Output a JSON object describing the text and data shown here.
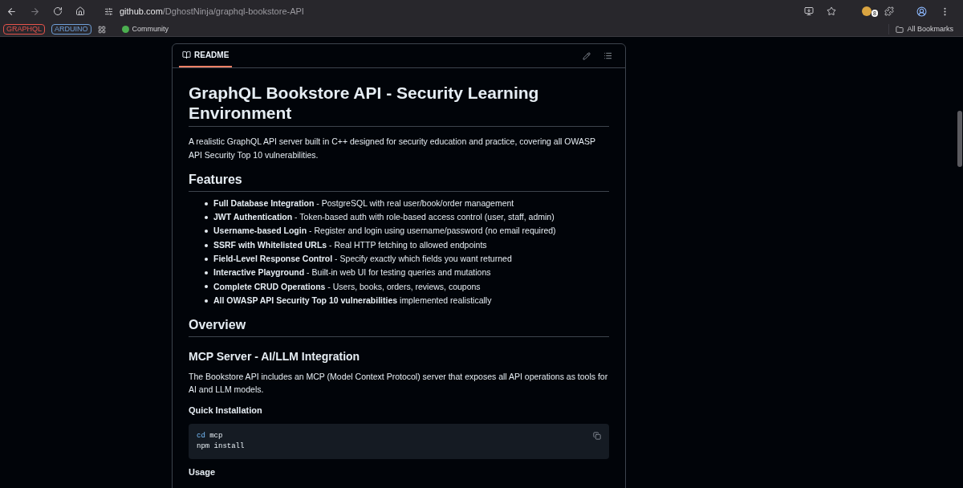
{
  "browser": {
    "url_host": "github.com",
    "url_path": "/DghostNinja/graphql-bookstore-API",
    "bookmarks": [
      {
        "label": "GRAPHQL",
        "kind": "tag",
        "color": "#e5534b"
      },
      {
        "label": "ARDUINO",
        "kind": "tag",
        "color": "#6e9fd8"
      },
      {
        "label": "Community",
        "kind": "link"
      }
    ],
    "all_bookmarks": "All Bookmarks",
    "extension_badge": "8"
  },
  "readme": {
    "tab": "README",
    "title": "GraphQL Bookstore API - Security Learning Environment",
    "intro": "A realistic GraphQL API server built in C++ designed for security education and practice, covering all OWASP API Security Top 10 vulnerabilities.",
    "features_heading": "Features",
    "features": [
      "**Full Database Integration** - PostgreSQL with real user/book/order management",
      "**JWT Authentication** - Token-based auth with role-based access control (user, staff, admin)",
      "**Username-based Login** - Register and login using username/password (no email required)",
      "**SSRF with Whitelisted URLs** - Real HTTP fetching to allowed endpoints",
      "**Field-Level Response Control** - Specify exactly which fields you want returned",
      "**Interactive Playground** - Built-in web UI for testing queries and mutations",
      "**Complete CRUD Operations** - Users, books, orders, reviews, coupons",
      "**All OWASP API Security Top 10 vulnerabilities** implemented realistically"
    ],
    "overview_heading": "Overview",
    "mcp_heading": "MCP Server - AI/LLM Integration",
    "mcp_text": "The Bookstore API includes an MCP (Model Context Protocol) server that exposes all API operations as tools for AI and LLM models.",
    "install_heading": "Quick Installation",
    "code_lines": [
      [
        {
          "text": "cd",
          "kind": "keyword"
        },
        {
          "text": " mcp",
          "kind": "plain"
        }
      ],
      [
        {
          "text": "npm install",
          "kind": "plain"
        }
      ]
    ],
    "usage_heading": "Usage"
  }
}
